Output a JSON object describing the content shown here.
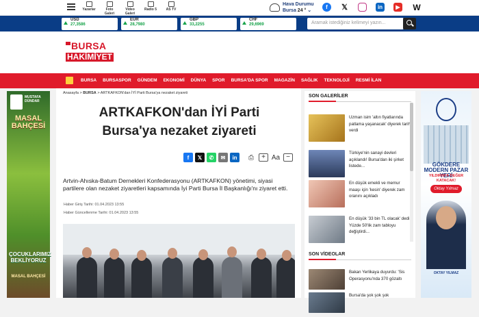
{
  "topbar": {
    "quicklinks": [
      {
        "label": "Yazarlar",
        "icon": "pen-icon"
      },
      {
        "label": "Foto Galeri",
        "icon": "camera-icon"
      },
      {
        "label": "Video Galeri",
        "icon": "video-icon"
      },
      {
        "label": "Radio 5",
        "icon": "radio-icon"
      },
      {
        "label": "AS TV",
        "icon": "tv-icon"
      }
    ],
    "weather": {
      "title": "Hava Durumu",
      "city": "Bursa",
      "temp": "24 °"
    },
    "socials": [
      "facebook-icon",
      "x-icon",
      "instagram-icon",
      "linkedin-icon",
      "youtube-icon",
      "w-icon"
    ]
  },
  "currencies": [
    {
      "code": "USD",
      "value": "27,3586"
    },
    {
      "code": "EUR",
      "value": "28,7980"
    },
    {
      "code": "GBP",
      "value": "33,2255"
    },
    {
      "code": "CHF",
      "value": "29,6969"
    }
  ],
  "search": {
    "placeholder": "Aramak istediğiniz kelimeyi yazın..."
  },
  "logo": {
    "line1": "BURSA",
    "line2": "HAKİMİYET"
  },
  "nav": {
    "items": [
      "BURSA",
      "BURSASPOR",
      "GÜNDEM",
      "EKONOMİ",
      "DÜNYA",
      "SPOR",
      "BURSA'DA SPOR",
      "MAGAZİN",
      "SAĞLIK",
      "TEKNOLOJİ",
      "RESMİ İLAN"
    ]
  },
  "left_ad": {
    "brand": "MUSTAFA DÜNDAR",
    "title": "MASAL BAHÇESİ",
    "slogan": "ÇOCUKLARIMIZ BEKLİYORUZ",
    "sub": "MASAL BAHÇESİ"
  },
  "article": {
    "breadcrumb": {
      "home": "Anasayfa",
      "sep": ">",
      "category": "BURSA",
      "current": "ARTKAFKON'dan İYİ Parti Bursa'ya nezaket ziyareti"
    },
    "headline": "ARTKAFKON'dan İYİ Parti Bursa'ya nezaket ziyareti",
    "summary": "Artvin-Ahıska-Batum Dernekleri Konfederasyonu (ARTKAFKON) yönetimi, siyasi partilere olan nezaket ziyaretleri kapsamında İyi Parti Bursa İl Başkanlığı'nı ziyaret etti.",
    "entry_date": "Haber Giriş Tarihi: 01.04.2023 13:55",
    "update_date": "Haber Güncellenme Tarihi: 01.04.2023 13:55",
    "font_label": "Aa"
  },
  "sidebar": {
    "galleries_title": "SON GALERİLER",
    "galleries": [
      {
        "text": "Uzman isim 'altın fiyatlarında patlama yaşanacak' diyerek tarih verdi",
        "color": "#c99a2e"
      },
      {
        "text": "Türkiye'nin sanayi devleri açıklandı! Bursa'dan iki şirket listede...",
        "color": "#5a6f96"
      },
      {
        "text": "En düşük emekli ve memur maaşı için 'kesin' diyerek zam oranını açıkladı",
        "color": "#c97b6b"
      },
      {
        "text": "En düşük '33 bin TL olacak' dedi: Yüzde 50'lik zam tabloyu değiştirdi...",
        "color": "#7e8a96"
      }
    ],
    "videos_title": "SON VİDEOLAR",
    "videos": [
      {
        "text": "Bakan Yerlikaya duyurdu: 'Sis Operasyonu'nda 370 gözaltı",
        "color": "#7d6a5a"
      },
      {
        "text": "Bursa'da şok şok şok",
        "color": "#4b5a6b"
      }
    ]
  },
  "right_ad": {
    "title": "GÖKDERE MODERN PAZAR YERİ",
    "slogan": "YILDIRIM'A DEĞER KATACAK!",
    "signature": "Oktay Yılmaz",
    "footer": "OKTAY YILMAZ"
  }
}
